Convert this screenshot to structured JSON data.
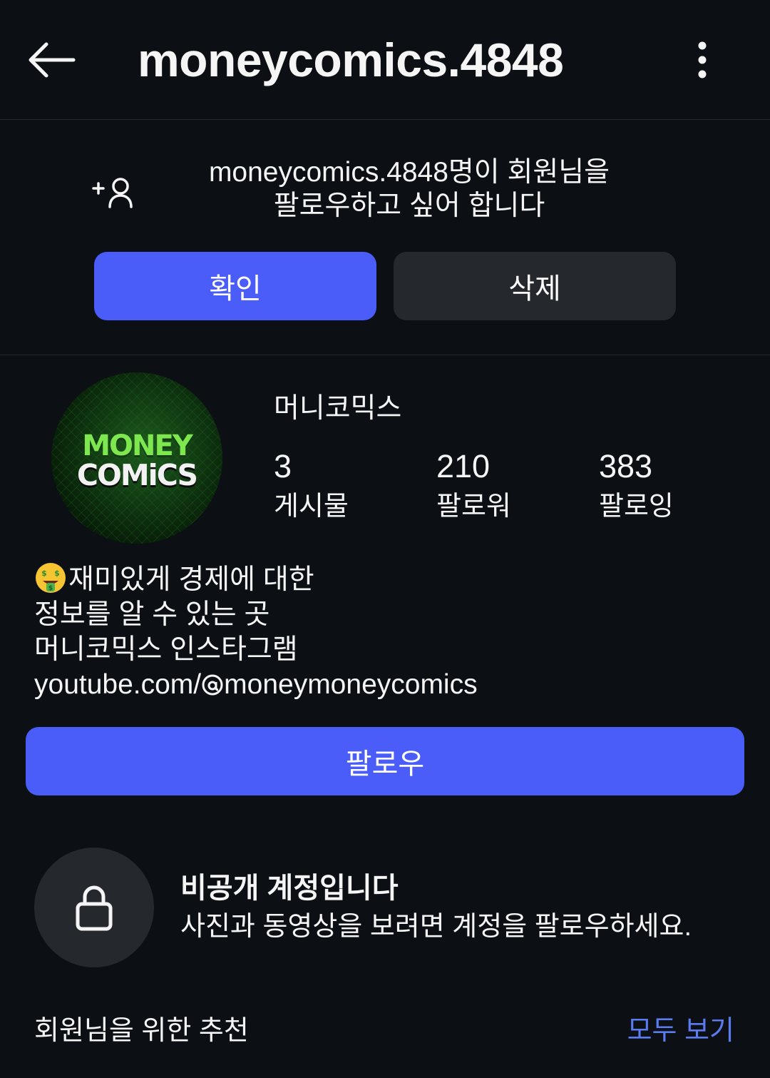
{
  "header": {
    "title": "moneycomics.4848",
    "back_icon": "arrow-left-icon",
    "more_icon": "more-vertical-icon"
  },
  "follow_request": {
    "line1": "moneycomics.4848명이 회원님을",
    "line2": "팔로우하고 싶어 합니다",
    "confirm_label": "확인",
    "delete_label": "삭제"
  },
  "profile": {
    "display_name": "머니코믹스",
    "avatar_text": {
      "line1": "MONEY",
      "line2": "COMiCS"
    },
    "stats": [
      {
        "value": "3",
        "label": "게시물"
      },
      {
        "value": "210",
        "label": "팔로워"
      },
      {
        "value": "383",
        "label": "팔로잉"
      }
    ],
    "bio": {
      "line1": "재미있게 경제에 대한",
      "line2": "정보를 알 수 있는 곳",
      "line3": "머니코믹스 인스타그램",
      "link_prefix": "youtube.com/",
      "link_handle": "moneymoneycomics"
    },
    "follow_label": "팔로우"
  },
  "private_account": {
    "title": "비공개 계정입니다",
    "description": "사진과 동영상을 보려면 계정을 팔로우하세요."
  },
  "recommendations": {
    "title": "회원님을 위한 추천",
    "see_all": "모두 보기"
  },
  "colors": {
    "background": "#0c1014",
    "primary_button": "#4a5df9",
    "secondary_button": "#25292e",
    "link": "#5b7bf0",
    "text": "#f5f5f5"
  }
}
